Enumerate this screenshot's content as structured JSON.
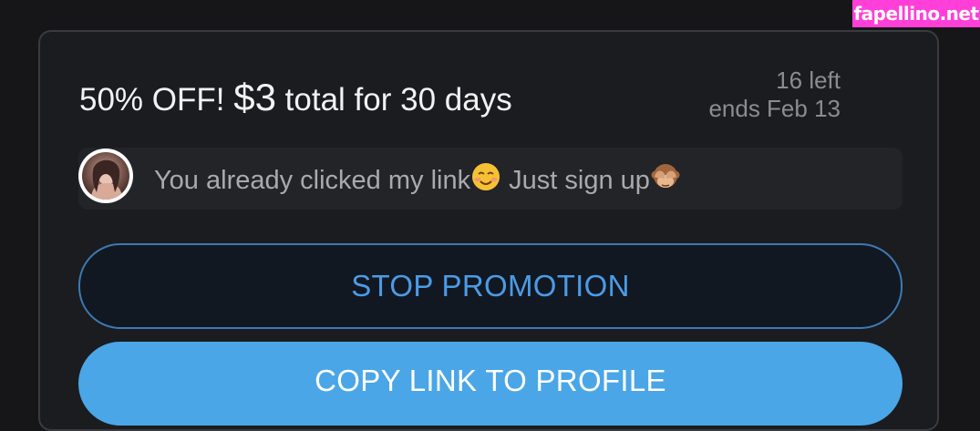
{
  "watermark": {
    "text": "fapellino.net",
    "color": "#ff3fd8"
  },
  "promotion": {
    "title_prefix": "50% OFF!",
    "price": "$3",
    "title_suffix": "total for 30 days",
    "remaining": "16 left",
    "ends": "ends Feb 13",
    "message": {
      "avatar_icon": "profile-avatar",
      "text_part1": "You already clicked my link",
      "emoji1": "smiling-face-icon",
      "text_part2": " Just sign up",
      "emoji2": "see-no-evil-monkey-icon"
    }
  },
  "buttons": {
    "stop_label": "STOP PROMOTION",
    "copy_label": "COPY LINK TO PROFILE"
  },
  "colors": {
    "background": "#161618",
    "card": "#1b1c20",
    "accent": "#4aa6e6",
    "stop_text": "#4b9be6"
  }
}
